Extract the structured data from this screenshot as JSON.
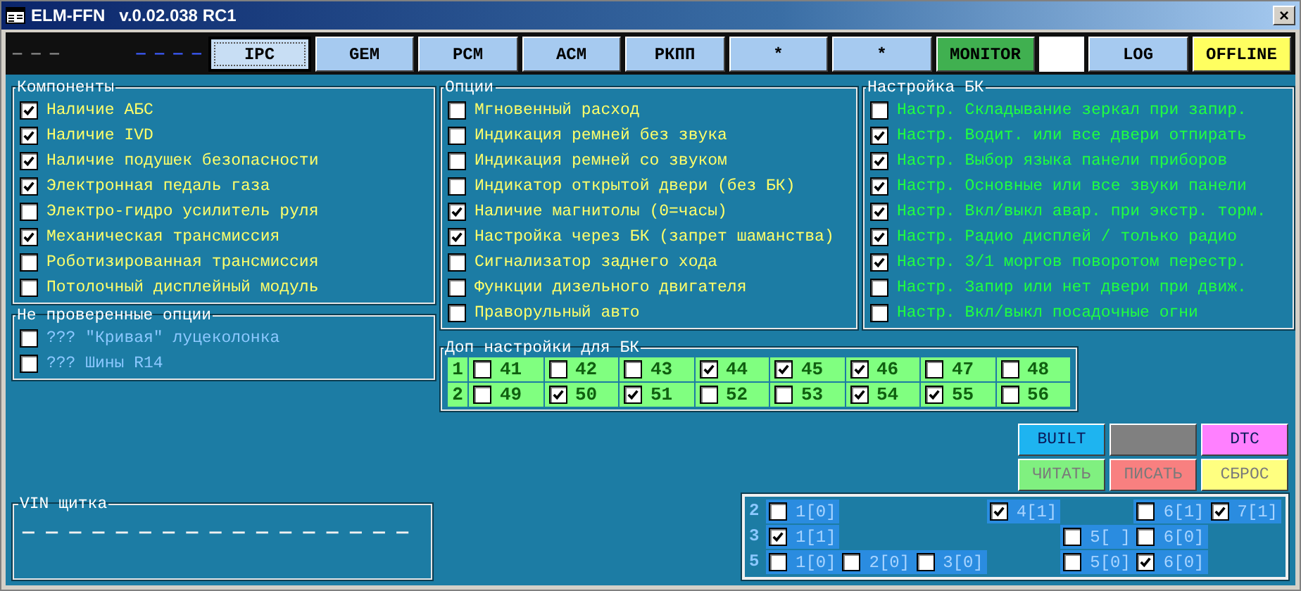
{
  "window": {
    "title": "ELM-FFN   v.0.02.038 RC1",
    "close": "×"
  },
  "toolbar": {
    "indicators": [
      {
        "text": "— — —",
        "color": "#8a8a8a"
      },
      {
        "text": "— — — —",
        "color": "#3c5cff"
      }
    ],
    "tabs": [
      {
        "label": "IPC",
        "selected": true,
        "color": "#c8def4"
      },
      {
        "label": "GEM",
        "selected": false,
        "color": "#a6caf0"
      },
      {
        "label": "PCM",
        "selected": false,
        "color": "#a6caf0"
      },
      {
        "label": "ACM",
        "selected": false,
        "color": "#a6caf0"
      },
      {
        "label": "РКПП",
        "selected": false,
        "color": "#a6caf0"
      },
      {
        "label": "*",
        "selected": false,
        "color": "#a6caf0"
      },
      {
        "label": "*",
        "selected": false,
        "color": "#a6caf0"
      },
      {
        "label": "MONITOR",
        "selected": false,
        "color": "#40b050"
      },
      {
        "selected": false,
        "color": "#ffffff"
      },
      {
        "label": "LOG",
        "selected": false,
        "color": "#a6caf0"
      },
      {
        "label": "OFFLINE",
        "selected": false,
        "color": "#ffff60"
      }
    ]
  },
  "components": {
    "title": "Компоненты",
    "items": [
      {
        "label": "Наличие АБС",
        "checked": true
      },
      {
        "label": "Наличие IVD",
        "checked": true
      },
      {
        "label": "Наличие подушек безопасности",
        "checked": true
      },
      {
        "label": "Электронная педаль газа",
        "checked": true
      },
      {
        "label": "Электро-гидро усилитель руля",
        "checked": false
      },
      {
        "label": "Механическая трансмиссия",
        "checked": true
      },
      {
        "label": "Роботизированная трансмиссия",
        "checked": false
      },
      {
        "label": "Потолочный дисплейный модуль",
        "checked": false
      }
    ]
  },
  "unverified": {
    "title": "Не проверенные опции",
    "items": [
      {
        "label": "??? \"Кривая\" луцеколонка",
        "checked": false
      },
      {
        "label": "??? Шины R14",
        "checked": false
      }
    ]
  },
  "options": {
    "title": "Опции",
    "items": [
      {
        "label": "Мгновенный расход",
        "checked": false
      },
      {
        "label": "Индикация ремней без звука",
        "checked": false
      },
      {
        "label": "Индикация ремней со звуком",
        "checked": false
      },
      {
        "label": "Индикатор открытой двери (без БК)",
        "checked": false
      },
      {
        "label": "Наличие магнитолы (0=часы)",
        "checked": true
      },
      {
        "label": "Настройка через БК (запрет шаманства)",
        "checked": true
      },
      {
        "label": "Сигнализатор заднего хода",
        "checked": false
      },
      {
        "label": "Функции дизельного двигателя",
        "checked": false
      },
      {
        "label": "Праворульный авто",
        "checked": false
      }
    ]
  },
  "bk_settings": {
    "title": "Настройка БК",
    "items": [
      {
        "label": "Настр. Складывание зеркал при запир.",
        "checked": false
      },
      {
        "label": "Настр. Водит. или все двери отпирать",
        "checked": true
      },
      {
        "label": "Настр. Выбор языка панели приборов",
        "checked": true
      },
      {
        "label": "Настр. Основные или все звуки панели",
        "checked": true
      },
      {
        "label": "Настр. Вкл/выкл авар. при экстр. торм.",
        "checked": true
      },
      {
        "label": "Настр. Радио дисплей / только радио",
        "checked": true
      },
      {
        "label": "Настр. 3/1 моргов поворотом перестр.",
        "checked": true
      },
      {
        "label": "Настр. Запир или нет двери при движ.",
        "checked": false
      },
      {
        "label": "Настр. Вкл/выкл посадочные огни",
        "checked": false
      }
    ]
  },
  "extra_bk": {
    "title": "Доп настройки для БК",
    "rows": [
      {
        "label": "1",
        "cells": [
          {
            "text": "41",
            "checked": false
          },
          {
            "text": "42",
            "checked": false
          },
          {
            "text": "43",
            "checked": false
          },
          {
            "text": "44",
            "checked": true
          },
          {
            "text": "45",
            "checked": true
          },
          {
            "text": "46",
            "checked": true
          },
          {
            "text": "47",
            "checked": false
          },
          {
            "text": "48",
            "checked": false
          }
        ]
      },
      {
        "label": "2",
        "cells": [
          {
            "text": "49",
            "checked": false
          },
          {
            "text": "50",
            "checked": true
          },
          {
            "text": "51",
            "checked": true
          },
          {
            "text": "52",
            "checked": false
          },
          {
            "text": "53",
            "checked": false
          },
          {
            "text": "54",
            "checked": true
          },
          {
            "text": "55",
            "checked": true
          },
          {
            "text": "56",
            "checked": false
          }
        ]
      }
    ]
  },
  "vin": {
    "title": "VIN щитка",
    "value": "— — — — — — — — — — — — — — — — —"
  },
  "buttons": [
    {
      "label": "BUILT",
      "color": "#1eb4f0",
      "disabled": false
    },
    {
      "color": "#808080"
    },
    {
      "label": "DTC",
      "color": "#ff80ff",
      "disabled": false
    },
    {
      "label": "ЧИТАТЬ",
      "color": "#80f080",
      "disabled": true
    },
    {
      "label": "ПИСАТЬ",
      "color": "#f88080",
      "disabled": true
    },
    {
      "label": "СБРОС",
      "color": "#ffff80",
      "disabled": true
    }
  ],
  "bits": {
    "rows": [
      {
        "label": "2",
        "cells": [
          {
            "text": "1[0]",
            "checked": false
          },
          null,
          null,
          {
            "text": "4[1]",
            "checked": true
          },
          null,
          {
            "text": "6[1]",
            "checked": false
          },
          {
            "text": "7[1]",
            "checked": true
          }
        ]
      },
      {
        "label": "3",
        "cells": [
          {
            "text": "1[1]",
            "checked": true
          },
          null,
          null,
          null,
          {
            "text": "5[ ]",
            "checked": false
          },
          {
            "text": "6[0]",
            "checked": false
          },
          null
        ]
      },
      {
        "label": "5",
        "cells": [
          {
            "text": "1[0]",
            "checked": false
          },
          {
            "text": "2[0]",
            "checked": false
          },
          {
            "text": "3[0]",
            "checked": false
          },
          null,
          {
            "text": "5[0]",
            "checked": false
          },
          {
            "text": "6[0]",
            "checked": true
          },
          null
        ]
      }
    ]
  }
}
